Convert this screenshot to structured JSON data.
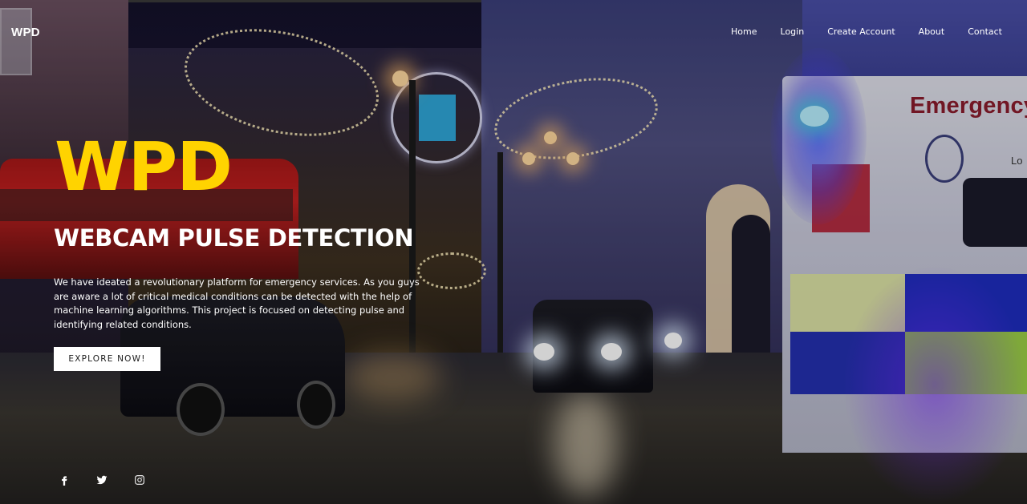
{
  "brand": {
    "logo": "WPD"
  },
  "nav": {
    "items": [
      {
        "label": "Home"
      },
      {
        "label": "Login"
      },
      {
        "label": "Create Account"
      },
      {
        "label": "About"
      },
      {
        "label": "Contact"
      }
    ]
  },
  "hero": {
    "title": "WPD",
    "subtitle": "WEBCAM PULSE DETECTION",
    "description": "We have ideated a revolutionary platform for emergency services. As you guys are aware a lot of critical medical conditions can be detected with the help of machine learning algorithms. This project is focused on detecting pulse and identifying related conditions.",
    "cta_label": "EXPLORE NOW!",
    "title_color": "#FFD300"
  },
  "background": {
    "ambulance_text": "Emergency",
    "ambulance_text_partial": "Lo"
  },
  "social": {
    "icons": [
      "facebook-icon",
      "twitter-icon",
      "instagram-icon"
    ]
  }
}
